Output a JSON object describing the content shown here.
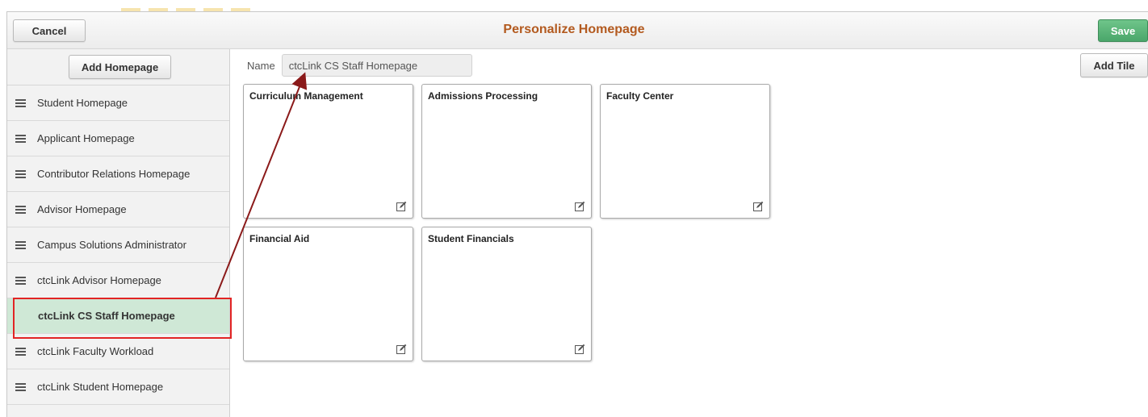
{
  "header": {
    "cancel_label": "Cancel",
    "title": "Personalize Homepage",
    "save_label": "Save"
  },
  "sidebar": {
    "add_homepage_label": "Add Homepage",
    "items": [
      {
        "label": "Student Homepage",
        "active": false
      },
      {
        "label": "Applicant Homepage",
        "active": false
      },
      {
        "label": "Contributor Relations Homepage",
        "active": false
      },
      {
        "label": "Advisor Homepage",
        "active": false
      },
      {
        "label": "Campus Solutions Administrator",
        "active": false
      },
      {
        "label": "ctcLink Advisor Homepage",
        "active": false
      },
      {
        "label": "ctcLink CS Staff Homepage",
        "active": true
      },
      {
        "label": "ctcLink Faculty Workload",
        "active": false
      },
      {
        "label": "ctcLink Student Homepage",
        "active": false
      }
    ]
  },
  "main": {
    "name_label": "Name",
    "name_value": "ctcLink CS Staff Homepage",
    "add_tile_label": "Add Tile",
    "tiles": [
      {
        "title": "Curriculum Management"
      },
      {
        "title": "Admissions Processing"
      },
      {
        "title": "Faculty Center"
      },
      {
        "title": "Financial Aid"
      },
      {
        "title": "Student Financials"
      }
    ]
  },
  "colors": {
    "title": "#b35a1f",
    "save_button": "#4aa66a",
    "active_item": "#cfe8d6",
    "highlight": "#e22424",
    "arrow": "#8b1a1a"
  },
  "icons": {
    "item_handle": "hamburger-icon",
    "tile_edit": "edit-icon"
  }
}
